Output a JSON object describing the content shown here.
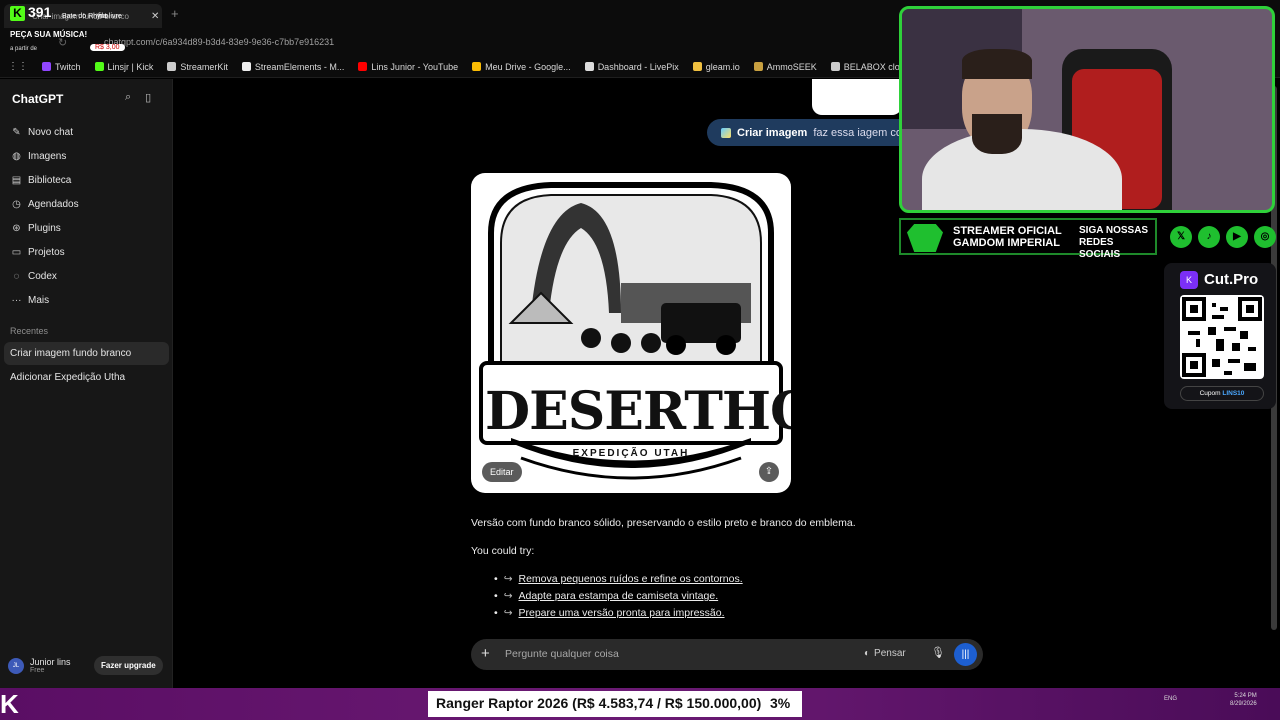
{
  "stream_overlay": {
    "kick_count": "391",
    "redeem_label": "Bate do Rhyno",
    "queue_label": "fila livre",
    "request_title": "PEÇA SUA MÚSICA!",
    "price_from": "a partir de",
    "price": "R$ 3,00"
  },
  "browser": {
    "tab_title": "Criar imagem fundo branco",
    "url": "chatgpt.com/c/6a934d89-b3d4-83e9-9e36-c7bb7e916231",
    "bookmarks": [
      {
        "label": "Twitch",
        "color": "#9146ff"
      },
      {
        "label": "Linsjr | Kick",
        "color": "#53fc18"
      },
      {
        "label": "StreamerKit",
        "color": "#cccccc"
      },
      {
        "label": "StreamElements - M...",
        "color": "#eeeeee"
      },
      {
        "label": "Lins Junior - YouTube",
        "color": "#ff0000"
      },
      {
        "label": "Meu Drive - Google...",
        "color": "#fbbc04"
      },
      {
        "label": "Dashboard - LivePix",
        "color": "#dddddd"
      },
      {
        "label": "gleam.io",
        "color": "#f0c040"
      },
      {
        "label": "AmmoSEEK",
        "color": "#c8a040"
      },
      {
        "label": "BELABOX cloud",
        "color": "#cccccc"
      },
      {
        "label": "Nightbot - Comm...",
        "color": "#333333"
      }
    ]
  },
  "sidebar": {
    "brand": "ChatGPT",
    "nav": [
      {
        "label": "Novo chat",
        "icon": "✎"
      },
      {
        "label": "Imagens",
        "icon": "◍"
      },
      {
        "label": "Biblioteca",
        "icon": "▤"
      },
      {
        "label": "Agendados",
        "icon": "◷"
      },
      {
        "label": "Plugins",
        "icon": "⊛"
      },
      {
        "label": "Projetos",
        "icon": "▭"
      },
      {
        "label": "Codex",
        "icon": "◌"
      },
      {
        "label": "Mais",
        "icon": "···"
      }
    ],
    "recent_label": "Recentes",
    "recent_chats": [
      "Criar imagem fundo branco",
      "Adicionar Expedição Utha"
    ],
    "user": {
      "initials": "JL",
      "name": "Junior lins",
      "plan": "Free"
    },
    "upgrade_label": "Fazer upgrade"
  },
  "conversation": {
    "user_message": {
      "tool": "Criar imagem",
      "text": "faz essa iagem com"
    },
    "image": {
      "title": "DESERTHON",
      "subtitle": "EXPEDIÇÃO UTAH"
    },
    "edit_label": "Editar",
    "response": "Versão com fundo branco sólido, preservando o estilo preto e branco do emblema.",
    "could_try": "You could try:",
    "suggestions": [
      "Remova pequenos ruídos e refine os contornos.",
      "Adapte para estampa de camiseta vintage.",
      "Prepare uma versão pronta para impressão."
    ]
  },
  "composer": {
    "placeholder": "Pergunte qualquer coisa",
    "think_label": "Pensar"
  },
  "webcam_banner": {
    "line1": "STREAMER OFICIAL",
    "line2": "GAMDOM IMPERIAL",
    "line3": "SIGA NOSSAS",
    "line4": "REDES SOCIAIS"
  },
  "cutpro": {
    "title": "Cut.Pro",
    "coupon_label": "Cupom",
    "coupon_code": "LINS10"
  },
  "ticker": {
    "text": "Ranger Raptor 2026 (R$ 4.583,74 / R$ 150.000,00)",
    "percent": "3%"
  },
  "taskbar": {
    "lang": "ENG",
    "time": "5:24 PM",
    "date": "8/29/2026"
  }
}
